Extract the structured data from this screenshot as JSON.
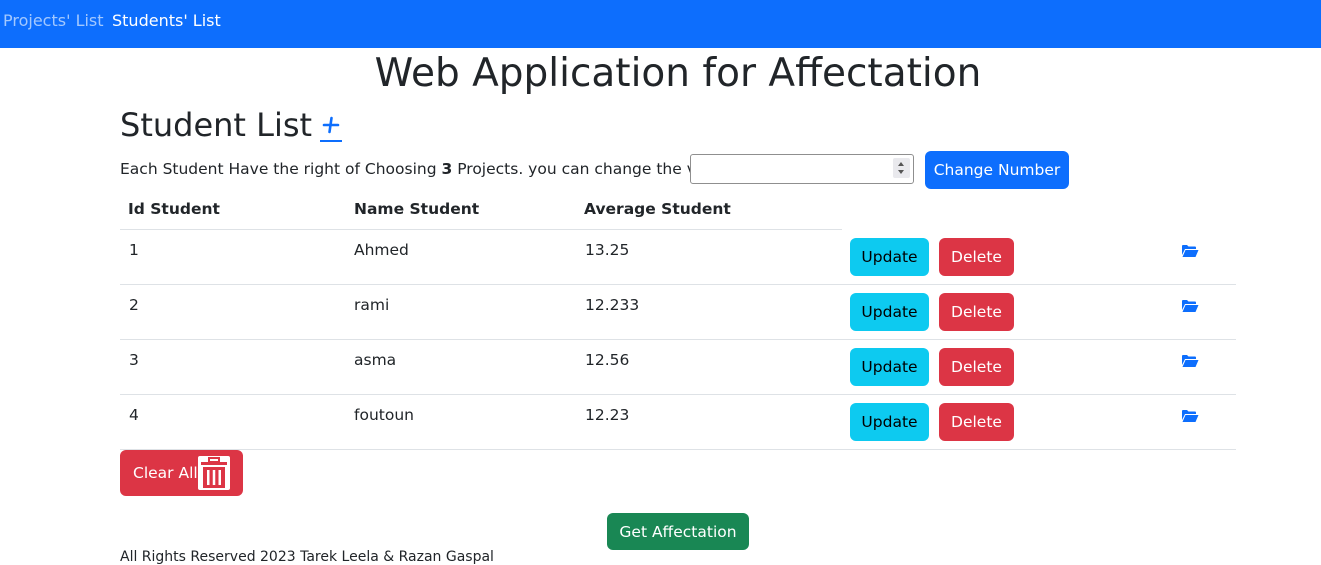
{
  "nav": {
    "projects": "Projects' List",
    "students": "Students' List"
  },
  "title": "Web Application for Affectation",
  "list_title": "Student List",
  "add_symbol": "+",
  "choice": {
    "prefix": "Each Student Have the right of Choosing",
    "count": "3",
    "suffix": "Projects. you can change the value:",
    "input_value": "",
    "button": "Change Number"
  },
  "table": {
    "headers": [
      "Id Student",
      "Name Student",
      "Average Student"
    ],
    "rows": [
      {
        "id": "1",
        "name": "Ahmed",
        "average": "13.25",
        "update": "Update",
        "delete": "Delete"
      },
      {
        "id": "2",
        "name": "rami",
        "average": "12.233",
        "update": "Update",
        "delete": "Delete"
      },
      {
        "id": "3",
        "name": "asma",
        "average": "12.56",
        "update": "Update",
        "delete": "Delete"
      },
      {
        "id": "4",
        "name": "foutoun",
        "average": "12.23",
        "update": "Update",
        "delete": "Delete"
      }
    ]
  },
  "clear_all": "Clear All",
  "get_affectation": "Get Affectation",
  "footer": "All Rights Reserved 2023 Tarek Leela & Razan Gaspal",
  "colors": {
    "primary": "#0d6efd",
    "info": "#0dcaf0",
    "danger": "#dc3545",
    "success": "#198754"
  },
  "icons": [
    "plus-icon",
    "spinner-icon",
    "folder-open-icon",
    "trash-icon"
  ]
}
